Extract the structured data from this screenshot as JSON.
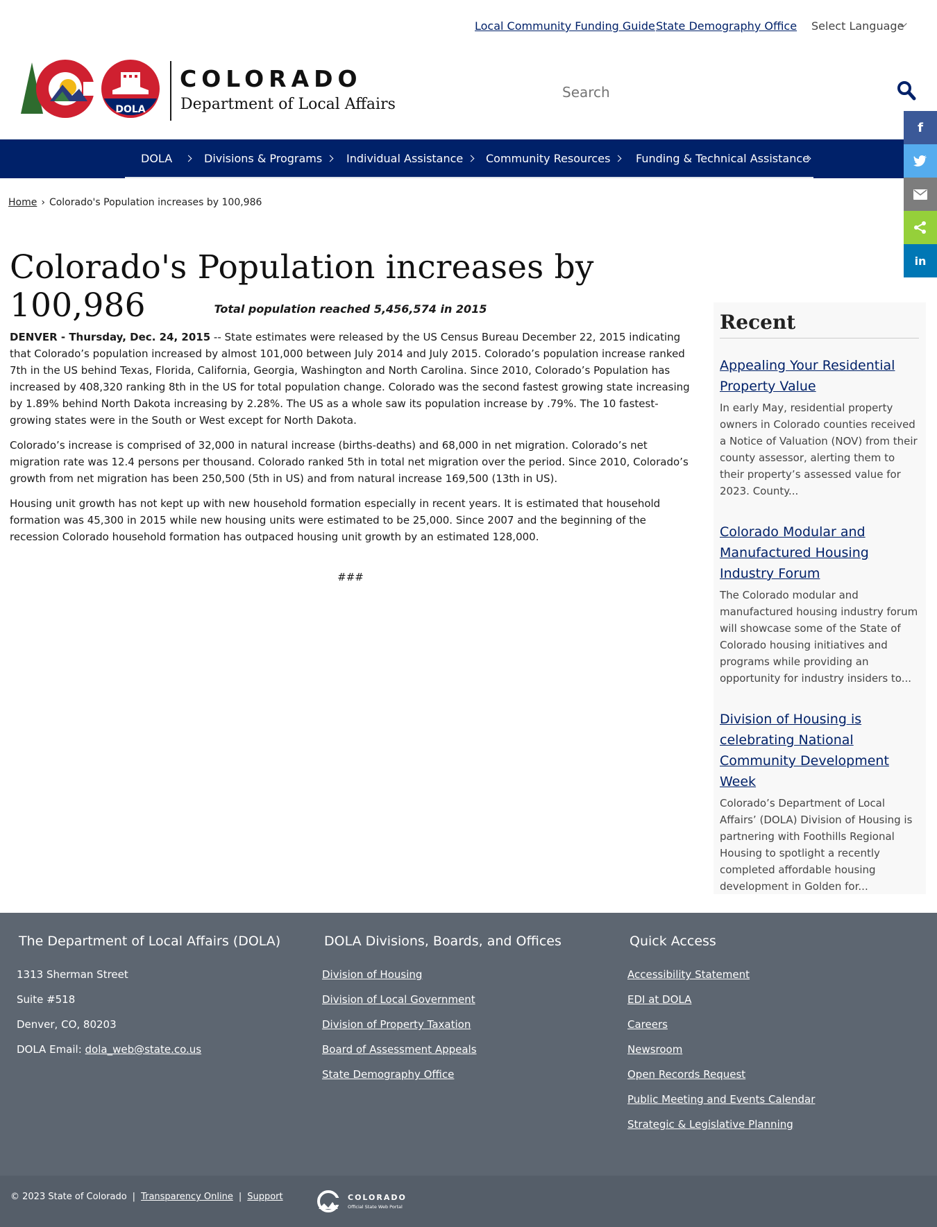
{
  "utility": {
    "link1": "Local Community Funding Guide",
    "link2": "State Demography Office",
    "language": "Select Language"
  },
  "header": {
    "brand_title": "COLORADO",
    "brand_subtitle": "Department of Local Affairs",
    "logo_badge": "DOLA",
    "search_placeholder": "Search"
  },
  "nav": {
    "items": [
      {
        "label": "DOLA"
      },
      {
        "label": "Divisions & Programs"
      },
      {
        "label": "Individual Assistance"
      },
      {
        "label": "Community Resources"
      },
      {
        "label": "Funding & Technical Assistance"
      }
    ]
  },
  "share": {
    "facebook": "f",
    "linkedin": "in"
  },
  "breadcrumb": {
    "home": "Home",
    "separator": "›",
    "current": "Colorado's Population increases by 100,986"
  },
  "page_title": "Colorado's Population increases by 100,986",
  "article": {
    "subhead": "Total population reached 5,456,574 in 2015",
    "dateline": "DENVER - Thursday, Dec. 24, 2015",
    "p1_rest": "  --  State estimates were released by the US Census Bureau December 22, 2015 indicating that Colorado’s population increased by almost 101,000  between July 2014 and July 2015.  Colorado’s population increase ranked 7th in the US behind Texas, Florida, California, Georgia, Washington and North Carolina. Since 2010, Colorado’s Population has increased by 408,320 ranking 8th in the US for total population change. Colorado was the second fastest growing state increasing by 1.89% behind North Dakota increasing by 2.28%.  The US as a whole saw its population increase by .79%.   The 10 fastest-growing states were in the South or West except for North Dakota.",
    "p2": "Colorado’s increase is comprised of 32,000 in natural increase (births-deaths) and 68,000 in net migration.  Colorado’s net migration rate was 12.4 persons per thousand. Colorado ranked 5th in total net migration over the period.  Since 2010, Colorado’s growth from net migration has been 250,500 (5th in US) and from natural increase 169,500 (13th in US).",
    "p3": "Housing unit growth has not kept up with new household formation especially in recent years.  It is estimated that household formation was 45,300 in 2015 while new housing units were estimated to be 25,000.  Since 2007 and the beginning of the recession Colorado household formation has outpaced housing unit growth by an estimated 128,000.",
    "end_mark": "###"
  },
  "recent": {
    "heading": "Recent",
    "items": [
      {
        "title": "Appealing Your Residential Property Value",
        "excerpt": "In early May, residential property owners in Colorado counties received a Notice of Valuation (NOV) from their county assessor, alerting them to their property’s assessed value for 2023. County..."
      },
      {
        "title": "Colorado Modular and Manufactured Housing Industry Forum",
        "excerpt": "The Colorado modular and manufactured housing industry forum will showcase some of the State of Colorado housing initiatives and programs while providing an opportunity for industry insiders to..."
      },
      {
        "title": "Division of Housing is celebrating National Community Development Week",
        "excerpt": "Colorado’s Department of Local Affairs’ (DOLA) Division of Housing is partnering with Foothills Regional Housing to spotlight a recently completed affordable housing development in Golden for..."
      }
    ]
  },
  "footer": {
    "col1": {
      "heading": "The Department of Local Affairs (DOLA)",
      "address1": "1313 Sherman Street",
      "address2": "Suite  #518",
      "address3": "Denver, CO, 80203",
      "email_label": "DOLA Email: ",
      "email": "dola_web@state.co.us"
    },
    "col2": {
      "heading": "DOLA Divisions, Boards, and Offices",
      "links": [
        "Division of Housing",
        "Division of Local Government",
        "Division of Property Taxation",
        "Board of Assessment Appeals",
        "State Demography Office"
      ]
    },
    "col3": {
      "heading": "Quick Access",
      "links": [
        "Accessibility Statement",
        "EDI at DOLA",
        "Careers",
        "Newsroom",
        "Open Records Request",
        "Public Meeting and Events Calendar",
        "Strategic & Legislative Planning"
      ]
    }
  },
  "bottom": {
    "copyright": "© 2023 State of Colorado",
    "pipe": "|",
    "link1": "Transparency Online",
    "link2": "Support",
    "portal_title": "COLORADO",
    "portal_sub": "Official State Web Portal"
  },
  "colors": {
    "nav_blue": "#002169",
    "link_blue": "#002169",
    "footer_gray": "#5d6671",
    "bottom_gray": "#555e69",
    "facebook": "#3b5998",
    "twitter": "#55acee",
    "email": "#7d7d7d",
    "sharethis": "#95d03a",
    "linkedin": "#0077b5"
  }
}
